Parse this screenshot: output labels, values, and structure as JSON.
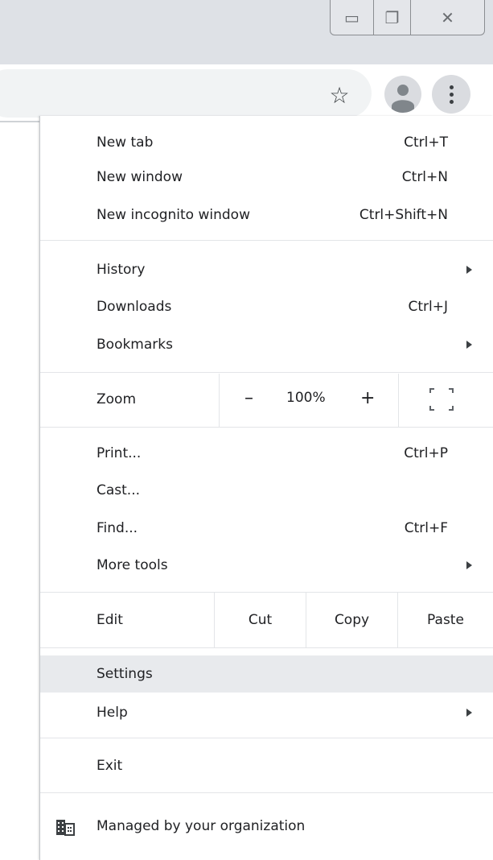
{
  "window_controls": {
    "minimize_glyph": "▭",
    "maximize_glyph": "❐",
    "close_glyph": "✕"
  },
  "toolbar": {
    "bookmark_star_glyph": "☆",
    "profile_icon": "person-icon",
    "menu_icon": "vertical-dots-icon"
  },
  "menu": {
    "new_tab": {
      "label": "New tab",
      "shortcut": "Ctrl+T"
    },
    "new_window": {
      "label": "New window",
      "shortcut": "Ctrl+N"
    },
    "new_incognito": {
      "label": "New incognito window",
      "shortcut": "Ctrl+Shift+N"
    },
    "history": {
      "label": "History"
    },
    "downloads": {
      "label": "Downloads",
      "shortcut": "Ctrl+J"
    },
    "bookmarks": {
      "label": "Bookmarks"
    },
    "zoom": {
      "label": "Zoom",
      "minus": "–",
      "level": "100%",
      "plus": "+"
    },
    "print": {
      "label": "Print...",
      "shortcut": "Ctrl+P"
    },
    "cast": {
      "label": "Cast..."
    },
    "find": {
      "label": "Find...",
      "shortcut": "Ctrl+F"
    },
    "more_tools": {
      "label": "More tools"
    },
    "edit": {
      "label": "Edit",
      "cut": "Cut",
      "copy": "Copy",
      "paste": "Paste"
    },
    "settings": {
      "label": "Settings"
    },
    "help": {
      "label": "Help"
    },
    "exit": {
      "label": "Exit"
    },
    "managed": {
      "label": "Managed by your organization"
    }
  },
  "colors": {
    "titlebar": "#dee1e6",
    "highlight": "#e8eaed",
    "separator": "#e3e5e8"
  }
}
